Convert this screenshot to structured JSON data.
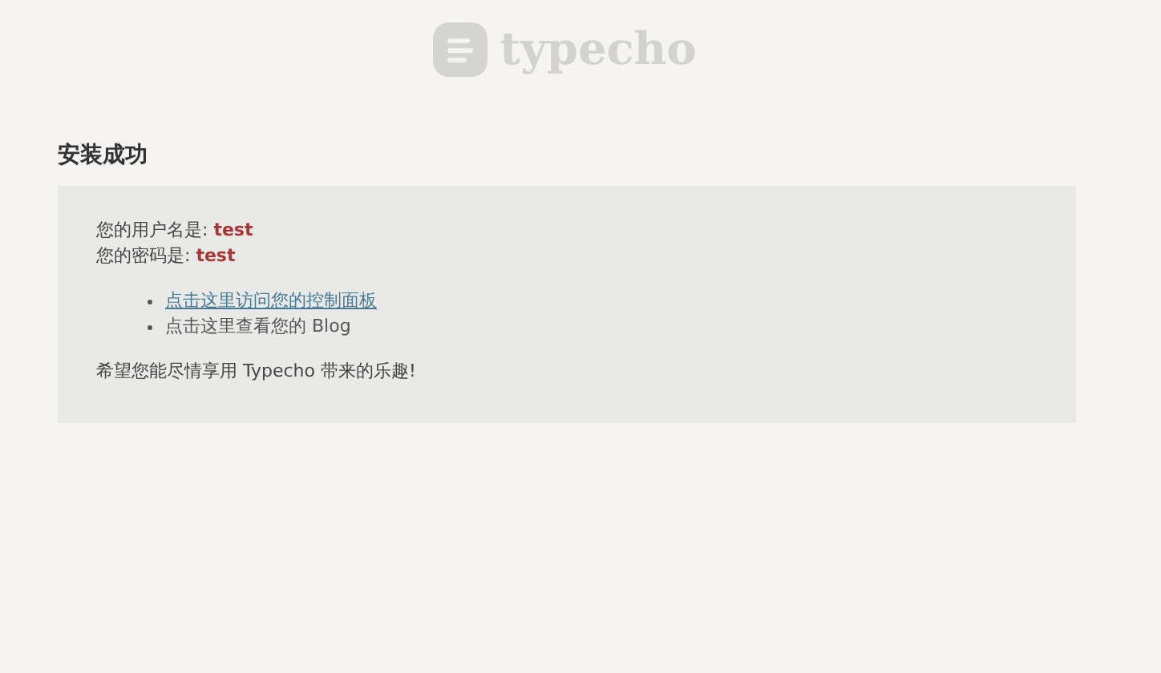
{
  "logo": {
    "text": "typecho"
  },
  "title": "安装成功",
  "credentials": [
    {
      "label": "您的用户名是: ",
      "value": "test"
    },
    {
      "label": "您的密码是: ",
      "value": "test"
    }
  ],
  "links": [
    {
      "text": "点击这里访问您的控制面板",
      "hovered": true
    },
    {
      "text": "点击这里查看您的 Blog",
      "hovered": false
    }
  ],
  "message": "希望您能尽情享用 Typecho 带来的乐趣!"
}
